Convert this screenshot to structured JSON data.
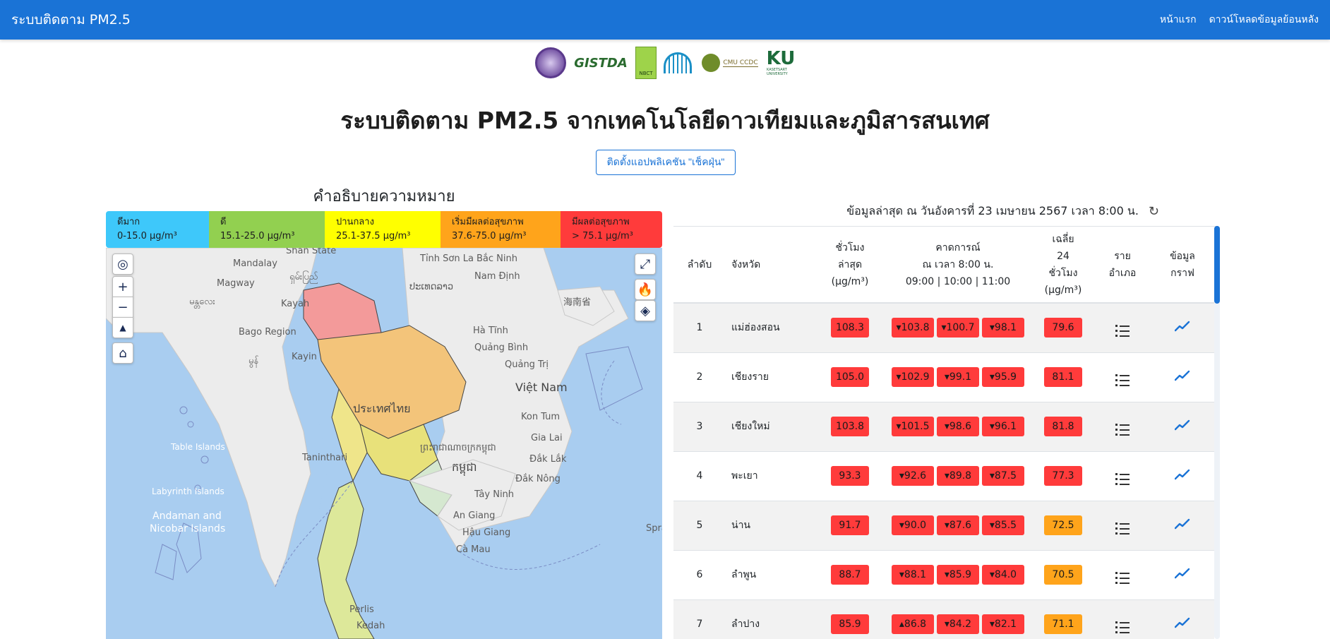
{
  "navbar": {
    "brand": "ระบบติดตาม PM2.5",
    "links": [
      "หน้าแรก",
      "ดาวน์โหลดข้อมูลย้อนหลัง"
    ]
  },
  "logos": {
    "gistda": "GISTDA",
    "nbct": "NBCT",
    "cmu": "CMU CCDC",
    "ku": "KU",
    "ku_sub": "KASETSART UNIVERSITY"
  },
  "page_title": "ระบบติดตาม PM2.5 จากเทคโนโลยีดาวเทียมและภูมิสารสนเทศ",
  "install_button": "ติดตั้งแอปพลิเคชัน \"เช็คฝุ่น\"",
  "legend": {
    "title": "คำอธิบายความหมาย",
    "items": [
      {
        "label": "ดีมาก",
        "range": "0-15.0 µg/m³",
        "color": "#3ec8fa"
      },
      {
        "label": "ดี",
        "range": "15.1-25.0 µg/m³",
        "color": "#92d050"
      },
      {
        "label": "ปานกลาง",
        "range": "25.1-37.5 µg/m³",
        "color": "#ffff00"
      },
      {
        "label": "เริ่มมีผลต่อสุขภาพ",
        "range": "37.6-75.0 µg/m³",
        "color": "#ffa41b"
      },
      {
        "label": "มีผลต่อสุขภาพ",
        "range": "> 75.1 µg/m³",
        "color": "#ff3b3b"
      }
    ]
  },
  "map": {
    "labels": [
      "Shan State",
      "Mandalay",
      "Magway",
      "ရှမ်းပြည်",
      "မန္တလေး",
      "Kayah",
      "Bago Region",
      "Kayin",
      "မွန်",
      "Taninthari",
      "Table Islands",
      "Labyrinth Islands",
      "Andaman and",
      "Nicobar Islands",
      "ປະເທດລາວ",
      "Tỉnh Sơn La",
      "Bắc Ninh",
      "Nam Định",
      "海南省",
      "Hà Tĩnh",
      "Quảng Bình",
      "Quảng Trị",
      "Việt Nam",
      "ประเทศไทย",
      "Kon Tum",
      "Gia Lai",
      "Đắk Lắk",
      "Đắk Nông",
      "Tây Ninh",
      "ព្រះរាជាណាចក្រកម្ពុជា",
      "កម្ពុជា",
      "An Giang",
      "Hậu Giang",
      "Cà Mau",
      "Perlis",
      "Kedah",
      "Spra"
    ]
  },
  "latest_label": "ข้อมูลล่าสุด ณ วันอังคารที่ 23 เมษายน 2567 เวลา 8:00 น.",
  "table": {
    "headers": {
      "rank": "ลำดับ",
      "province": "จังหวัด",
      "latest_1": "ชั่วโมง",
      "latest_2": "ล่าสุด",
      "latest_3": "(µg/m³)",
      "forecast_1": "คาดการณ์",
      "forecast_2": "ณ เวลา 8:00 น.",
      "forecast_3": "09:00 | 10:00 | 11:00",
      "avg_1": "เฉลี่ย",
      "avg_2": "24",
      "avg_3": "ชั่วโมง",
      "avg_4": "(µg/m³)",
      "district_1": "ราย",
      "district_2": "อำเภอ",
      "graph_1": "ข้อมูล",
      "graph_2": "กราฟ"
    },
    "rows": [
      {
        "rank": "1",
        "province": "แม่ฮ่องสอน",
        "latest": "108.3",
        "f1": "▾103.8",
        "f2": "▾100.7",
        "f3": "▾98.1",
        "avg": "79.6",
        "avg_level": "red"
      },
      {
        "rank": "2",
        "province": "เชียงราย",
        "latest": "105.0",
        "f1": "▾102.9",
        "f2": "▾99.1",
        "f3": "▾95.9",
        "avg": "81.1",
        "avg_level": "red"
      },
      {
        "rank": "3",
        "province": "เชียงใหม่",
        "latest": "103.8",
        "f1": "▾101.5",
        "f2": "▾98.6",
        "f3": "▾96.1",
        "avg": "81.8",
        "avg_level": "red"
      },
      {
        "rank": "4",
        "province": "พะเยา",
        "latest": "93.3",
        "f1": "▾92.6",
        "f2": "▾89.8",
        "f3": "▾87.5",
        "avg": "77.3",
        "avg_level": "red"
      },
      {
        "rank": "5",
        "province": "น่าน",
        "latest": "91.7",
        "f1": "▾90.0",
        "f2": "▾87.6",
        "f3": "▾85.5",
        "avg": "72.5",
        "avg_level": "orange"
      },
      {
        "rank": "6",
        "province": "ลำพูน",
        "latest": "88.7",
        "f1": "▾88.1",
        "f2": "▾85.9",
        "f3": "▾84.0",
        "avg": "70.5",
        "avg_level": "orange"
      },
      {
        "rank": "7",
        "province": "ลำปาง",
        "latest": "85.9",
        "f1": "▴86.8",
        "f2": "▾84.2",
        "f3": "▾82.1",
        "avg": "71.1",
        "avg_level": "orange"
      }
    ]
  }
}
